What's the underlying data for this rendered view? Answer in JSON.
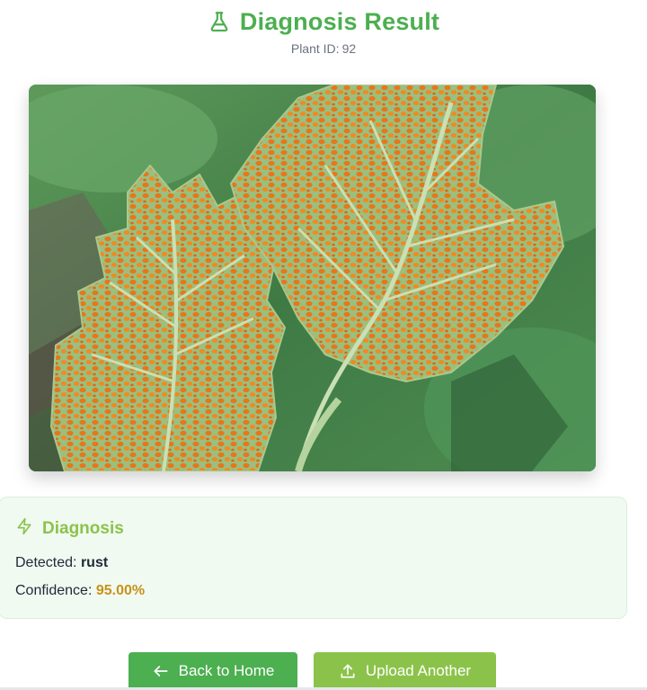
{
  "header": {
    "icon": "flask-icon",
    "title": "Diagnosis Result",
    "plant_id_label": "Plant ID:",
    "plant_id_value": "92"
  },
  "image": {
    "description_icon": "leaf-photo"
  },
  "diagnosis": {
    "icon": "lightning-icon",
    "title": "Diagnosis",
    "detected_label": "Detected:",
    "detected_value": "rust",
    "confidence_label": "Confidence:",
    "confidence_value": "95.00%"
  },
  "actions": {
    "back_icon": "arrow-left-icon",
    "back_label": "Back to Home",
    "upload_icon": "upload-icon",
    "upload_label": "Upload Another"
  },
  "colors": {
    "primary_green": "#4caf50",
    "light_green": "#8bc34a",
    "confidence_gold": "#c8921a",
    "card_bg": "#f0faf1"
  }
}
